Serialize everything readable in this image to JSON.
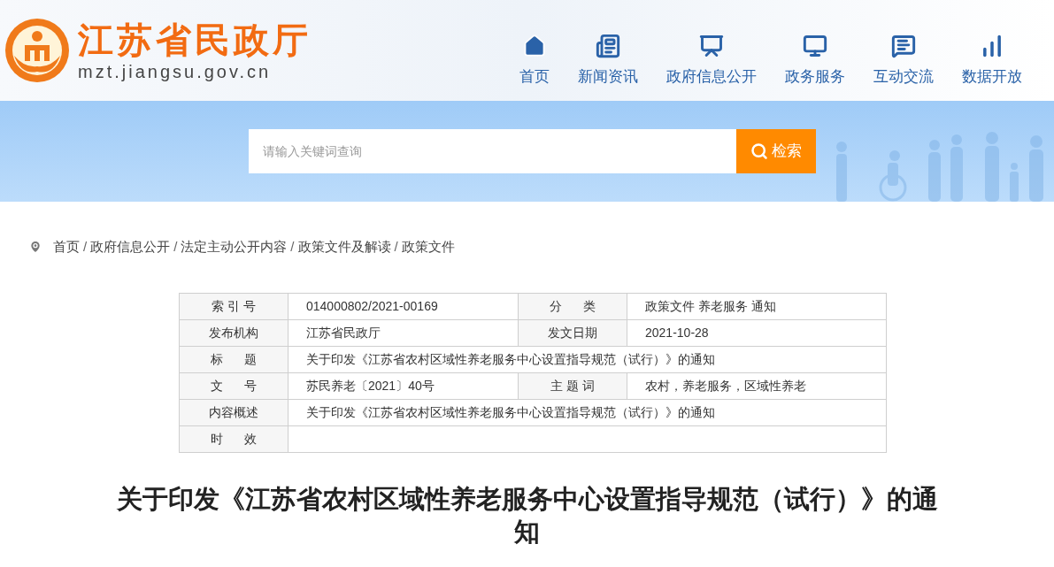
{
  "header": {
    "site_name": "江苏省民政厅",
    "domain": "mzt.jiangsu.gov.cn",
    "nav": [
      {
        "label": "首页"
      },
      {
        "label": "新闻资讯"
      },
      {
        "label": "政府信息公开"
      },
      {
        "label": "政务服务"
      },
      {
        "label": "互动交流"
      },
      {
        "label": "数据开放"
      }
    ]
  },
  "search": {
    "placeholder": "请输入关键词查询",
    "button": "检索"
  },
  "breadcrumb": {
    "separator": "/",
    "items": [
      "首页",
      "政府信息公开",
      "法定主动公开内容",
      "政策文件及解读",
      "政策文件"
    ]
  },
  "info_table": {
    "rows": [
      {
        "label": "索 引 号",
        "value": "014000802/2021-00169",
        "label_2": "分      类",
        "value_2": "政策文件 养老服务 通知"
      },
      {
        "label": "发布机构",
        "value": "江苏省民政厅",
        "label_2": "发文日期",
        "value_2": "2021-10-28"
      },
      {
        "label": "标      题",
        "value": "关于印发《江苏省农村区域性养老服务中心设置指导规范（试行）》的通知"
      },
      {
        "label": "文      号",
        "value": "苏民养老〔2021〕40号",
        "label_2": "主 题 词",
        "value_2": "农村，养老服务，区域性养老"
      },
      {
        "label": "内容概述",
        "value": "关于印发《江苏省农村区域性养老服务中心设置指导规范（试行）》的通知"
      },
      {
        "label": "时      效"
      }
    ]
  },
  "article": {
    "title": "关于印发《江苏省农村区域性养老服务中心设置指导规范（试行）》的通知"
  }
}
